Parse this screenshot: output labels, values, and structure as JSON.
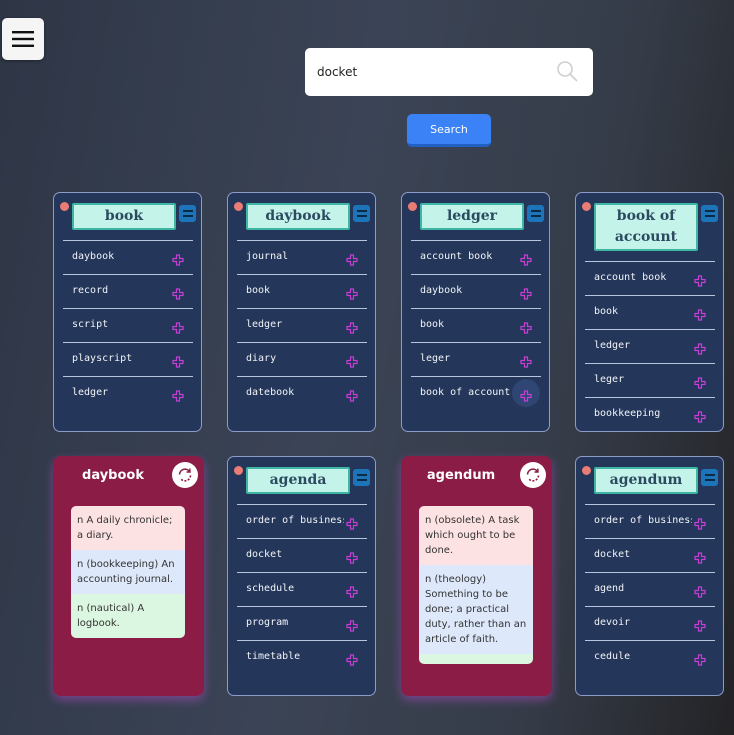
{
  "search": {
    "value": "docket",
    "button_label": "Search"
  },
  "cards": [
    {
      "title": "book",
      "items": [
        "daybook",
        "record",
        "script",
        "playscript",
        "ledger"
      ]
    },
    {
      "title": "daybook",
      "items": [
        "journal",
        "book",
        "ledger",
        "diary",
        "datebook"
      ]
    },
    {
      "title": "ledger",
      "items": [
        "account book",
        "daybook",
        "book",
        "leger",
        "book of account"
      ]
    },
    {
      "title": "book of account",
      "items": [
        "account book",
        "book",
        "ledger",
        "leger",
        "bookkeeping"
      ]
    },
    {
      "title": "agenda",
      "items": [
        "order of business",
        "docket",
        "schedule",
        "program",
        "timetable"
      ]
    },
    {
      "title": "agendum",
      "items": [
        "order of business",
        "docket",
        "agend",
        "devoir",
        "cedule"
      ]
    }
  ],
  "definition_cards": [
    {
      "word": "daybook",
      "definitions": [
        "n A daily chronicle; a diary.",
        "n (bookkeeping) An accounting journal.",
        "n (nautical) A logbook."
      ]
    },
    {
      "word": "agendum",
      "definitions": [
        "n (obsolete) A task which ought to be done.",
        "n (theology) Something to be done; a practical duty, rather than an article of faith.",
        ""
      ]
    }
  ],
  "colors": {
    "card_bg": "#243659",
    "definition_card_bg": "#8a1c45",
    "title_box_bg": "#c4f3ea",
    "plus_icon": "#c63fd6",
    "search_button": "#3b82f6"
  }
}
